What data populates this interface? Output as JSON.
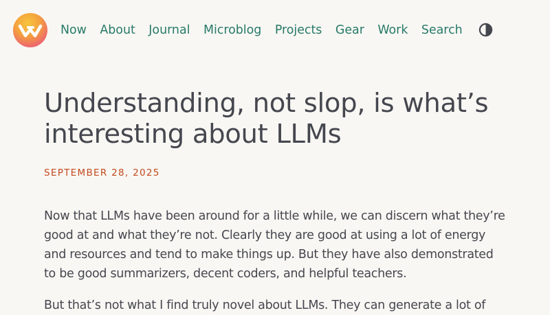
{
  "header": {
    "logo_icon": "wy-logo-icon",
    "nav": [
      {
        "label": "Now"
      },
      {
        "label": "About"
      },
      {
        "label": "Journal"
      },
      {
        "label": "Microblog"
      },
      {
        "label": "Projects"
      },
      {
        "label": "Gear"
      },
      {
        "label": "Work"
      },
      {
        "label": "Search"
      }
    ],
    "theme_toggle_icon": "contrast-icon"
  },
  "article": {
    "title": "Understanding, not slop, is what’s interesting about LLMs",
    "date": "SEPTEMBER 28, 2025",
    "paragraphs": [
      "Now that LLMs have been around for a little while, we can discern what they’re good at and what they’re not. Clearly they are good at using a lot of energy and resources and tend to make things up. But they have also demonstrated to be good summarizers, decent coders, and helpful teachers.",
      "But that’s not what I find truly novel about LLMs. They can generate a lot of"
    ]
  },
  "colors": {
    "background": "#f9f7f3",
    "nav_link": "#267a69",
    "text": "#45474f",
    "date": "#c24a1e"
  }
}
